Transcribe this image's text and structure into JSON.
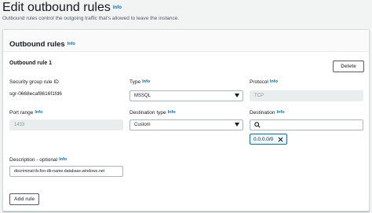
{
  "header": {
    "title": "Edit outbound rules",
    "info": "Info",
    "description": "Outbound rules control the outgoing traffic that's allowed to leave the instance."
  },
  "panel": {
    "title": "Outbound rules",
    "info": "Info"
  },
  "rule": {
    "title": "Outbound rule 1",
    "delete_label": "Delete",
    "sgr_id_label": "Security group rule ID",
    "sgr_id_value": "sgr-0668ecaf8616f1fd6",
    "type_label": "Type",
    "type_info": "Info",
    "type_value": "MSSQL",
    "protocol_label": "Protocol",
    "protocol_info": "Info",
    "protocol_value": "TCP",
    "port_label": "Port range",
    "port_info": "Info",
    "port_value": "1433",
    "dest_type_label": "Destination type",
    "dest_type_info": "Info",
    "dest_type_value": "Custom",
    "dest_label": "Destination",
    "dest_info": "Info",
    "dest_search_value": "",
    "dest_token": "0.0.0.0/0",
    "desc_label": "Description - optional",
    "desc_info": "Info",
    "desc_value": "discriminat:tls:foo-db-name.database.windows.net"
  },
  "add_rule_label": "Add rule",
  "colors": {
    "link": "#0073bb",
    "token_border": "#0073bb",
    "token_bg": "#f1faff"
  }
}
